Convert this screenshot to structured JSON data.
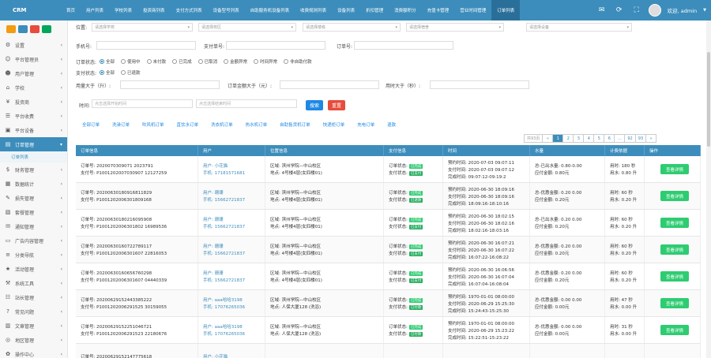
{
  "brand": "CRM",
  "nav": [
    "首页",
    "用户列表",
    "学校列表",
    "投资商列表",
    "支付方式列表",
    "设备型号列表",
    "自助服务机设备列表",
    "收费规则列表",
    "设备列表",
    "折扣管理",
    "消费额积分",
    "充值卡管理",
    "营业时间管理",
    "订单列表"
  ],
  "user": {
    "greeting": "欢迎, admin"
  },
  "icons": {
    "mail": "mail-icon",
    "refresh": "refresh-icon",
    "expand": "expand-icon"
  },
  "sidebar": {
    "items": [
      "设置",
      "平台管理员",
      "用户管理",
      "学校",
      "投资商",
      "平台收费",
      "平台设备",
      "订单管理",
      "财务管理",
      "数据统计",
      "损失管理",
      "套餐管理",
      "通知管理",
      "广告内容管理",
      "分类导航",
      "活动管理",
      "系统工具",
      "站长管理",
      "常见问题",
      "文章管理",
      "地区管理",
      "操作中心"
    ],
    "active_index": 7,
    "sub": "订单列表"
  },
  "filters": {
    "position_label": "位置:",
    "selects": [
      "请选择学校",
      "请选择校区",
      "请选择楼栋",
      "请选择宿舍",
      "请选择设备"
    ],
    "phone_label": "手机号:",
    "pay_no_label": "支付单号:",
    "order_no_label": "订单号:",
    "order_status_label": "订单状态:",
    "order_status": [
      "全部",
      "使用中",
      "未付款",
      "已完成",
      "已取消",
      "金额异常",
      "时间异常",
      "非自助付款"
    ],
    "pay_status_label": "支付状态:",
    "pay_status": [
      "全部",
      "已退款"
    ],
    "use_gt_label": "用量大于（升）:",
    "amount_gt_label": "订单金额大于（元）:",
    "time_gt_label": "用时大于（秒）:",
    "time_label": "时间:",
    "start_ph": "点击选择开始时间",
    "end_ph": "点击选择结束时间",
    "search": "搜索",
    "reset": "重置"
  },
  "tabs": [
    "全部订单",
    "洗澡订单",
    "吹风机订单",
    "直饮水订单",
    "洗衣机订单",
    "热水机订单",
    "自助售货机订单",
    "快递柜订单",
    "充电订单",
    "退款"
  ],
  "pager": [
    "«",
    "1",
    "2",
    "3",
    "4",
    "5",
    "6",
    "...",
    "92",
    "93",
    "»"
  ],
  "pager_total": "共93页",
  "columns": [
    "订单信息",
    "用户",
    "位置信息",
    "支付信息",
    "时间",
    "水量",
    "计费依据",
    "操作"
  ],
  "rows": [
    {
      "order_no": "订单号: 2020070309071 2023791",
      "pay_no": "支付号: P1001202007030907 12127259",
      "user": "用户: 小花猫",
      "phone": "手机: 17181571681",
      "area": "区域: 滨州学院—中山校区",
      "loc": "地点: 4号楼4层(女四楼01)",
      "status": "订单状态:",
      "status_b": "已完成",
      "pay": "支付状态:",
      "pay_b": "已支付",
      "t1": "预约时间: 2020-07-03 09:07:11",
      "t2": "支付时间: 2020-07-03 09:07:12",
      "t3": "完成时间: 09:07:12-09:19:2",
      "w1": "总-已出水量: 0.80-0.00",
      "w2": "应付金额: 0.80元",
      "u1": "用时: 180 秒",
      "u2": "用水: 0.80 升",
      "op": "查看详情"
    },
    {
      "order_no": "订单号: 20200630180916811829",
      "pay_no": "支付号: P1001202006301809168",
      "user": "用户: 珊珊",
      "phone": "手机: 15662721837",
      "area": "区域: 滨州学院—中山校区",
      "loc": "地点: 4号楼4层(女四楼01)",
      "status": "订单状态:",
      "status_b": "已完成",
      "pay": "支付状态:",
      "pay_b": "已退款",
      "t1": "预约时间: 2020-06-30 18:09:16",
      "t2": "支付时间: 2020-06-30 18:09:16",
      "t3": "完成时间: 18:09:16-18:10:16",
      "w1": "总-优惠金额: 0.20 0.00",
      "w2": "应付金额: 0.20元",
      "u1": "用时: 60 秒",
      "u2": "用水: 0.20 升",
      "op": "查看详情"
    },
    {
      "order_no": "订单号: 20200630180216095908",
      "pay_no": "支付号: P1001202006301802 16989536",
      "user": "用户: 珊珊",
      "phone": "手机: 15662721837",
      "area": "区域: 滨州学院—中山校区",
      "loc": "地点: 4号楼4层(女四楼01)",
      "status": "订单状态:",
      "status_b": "已完成",
      "pay": "支付状态:",
      "pay_b": "已支付",
      "t1": "预约时间: 2020-06-30 18:02:15",
      "t2": "支付时间: 2020-06-30 18:02:16",
      "t3": "完成时间: 18:02:16-18:03:16",
      "w1": "总-已出水量: 0.20 0.00",
      "w2": "应付金额: 0.20元",
      "u1": "用时: 60 秒",
      "u2": "用水: 0.20 升",
      "op": "查看详情"
    },
    {
      "order_no": "订单号: 20200630160722789117",
      "pay_no": "支付号: P1001202006301607 22816053",
      "user": "用户: 珊珊",
      "phone": "手机: 15662721837",
      "area": "区域: 滨州学院—中山校区",
      "loc": "地点: 4号楼4层(女四楼01)",
      "status": "订单状态:",
      "status_b": "已完成",
      "pay": "支付状态:",
      "pay_b": "已支付",
      "t1": "预约时间: 2020-06-30 16:07:21",
      "t2": "支付时间: 2020-06-30 16:07:22",
      "t3": "完成时间: 16:07:22-16:08:22",
      "w1": "总-优惠金额: 0.20 0.00",
      "w2": "应付金额: 0.20元",
      "u1": "用时: 60 秒",
      "u2": "用水: 0.20 升",
      "op": "查看详情"
    },
    {
      "order_no": "订单号: 20200630160656760298",
      "pay_no": "支付号: P1001202006301607 04440339",
      "user": "用户: 珊珊",
      "phone": "手机: 15662721837",
      "area": "区域: 滨州学院—中山校区",
      "loc": "地点: 4号楼4层(女四楼01)",
      "status": "订单状态:",
      "status_b": "已完成",
      "pay": "支付状态:",
      "pay_b": "已支付",
      "t1": "预约时间: 2020-06-30 16:06:56",
      "t2": "支付时间: 2020-06-30 16:07:04",
      "t3": "完成时间: 16:07:04-16:08:04",
      "w1": "总-优惠金额: 0.20 0.00",
      "w2": "应付金额: 0.20元",
      "u1": "用时: 60 秒",
      "u2": "用水: 0.20 升",
      "op": "查看详情"
    },
    {
      "order_no": "订单号: 20200629152443385222",
      "pay_no": "支付号: P1001202006291525 30159055",
      "user": "用户: aaa哈哈3198",
      "phone": "手机: 17076265036",
      "area": "区域: 滨州学院—中山校区",
      "loc": "地点: 人保大厦128 (洗浴)",
      "status": "订单状态:",
      "status_b": "已完成",
      "pay": "支付状态:",
      "pay_b": "已付款",
      "t1": "预约时间: 1970-01-01 08:00:00",
      "t2": "支付时间: 2020-06-29 15:25:30",
      "t3": "完成时间: 15:24:43-15:25:30",
      "w1": "总-优惠金额: 0.00 0.00",
      "w2": "应付金额: 0.00元",
      "u1": "用时: 47 秒",
      "u2": "用水: 0.00 升",
      "op": "查看详情"
    },
    {
      "order_no": "订单号: 20200629152251046721",
      "pay_no": "支付号: P1001202006291523 22180676",
      "user": "用户: aaa哈哈3198",
      "phone": "手机: 17076265036",
      "area": "区域: 滨州学院—中山校区",
      "loc": "地点: 人保大厦128 (洗浴)",
      "status": "订单状态:",
      "status_b": "已完成",
      "pay": "支付状态:",
      "pay_b": "已付款",
      "t1": "预约时间: 1970-01-01 08:00:00",
      "t2": "支付时间: 2020-06-29 15:23:22",
      "t3": "完成时间: 15:22:51-15:23:22",
      "w1": "总-优惠金额: 0.00 0.00",
      "w2": "应付金额: 0.00元",
      "u1": "用时: 31 秒",
      "u2": "用水: 0.00 升",
      "op": "查看详情"
    },
    {
      "order_no": "订单号: 20200629152147775618",
      "pay_no": "",
      "user": "用户: 小花猫",
      "phone": "",
      "area": "",
      "loc": "",
      "status": "",
      "status_b": "",
      "pay": "",
      "pay_b": "",
      "t1": "",
      "t2": "",
      "t3": "",
      "w1": "",
      "w2": "",
      "u1": "",
      "u2": "",
      "op": ""
    }
  ]
}
